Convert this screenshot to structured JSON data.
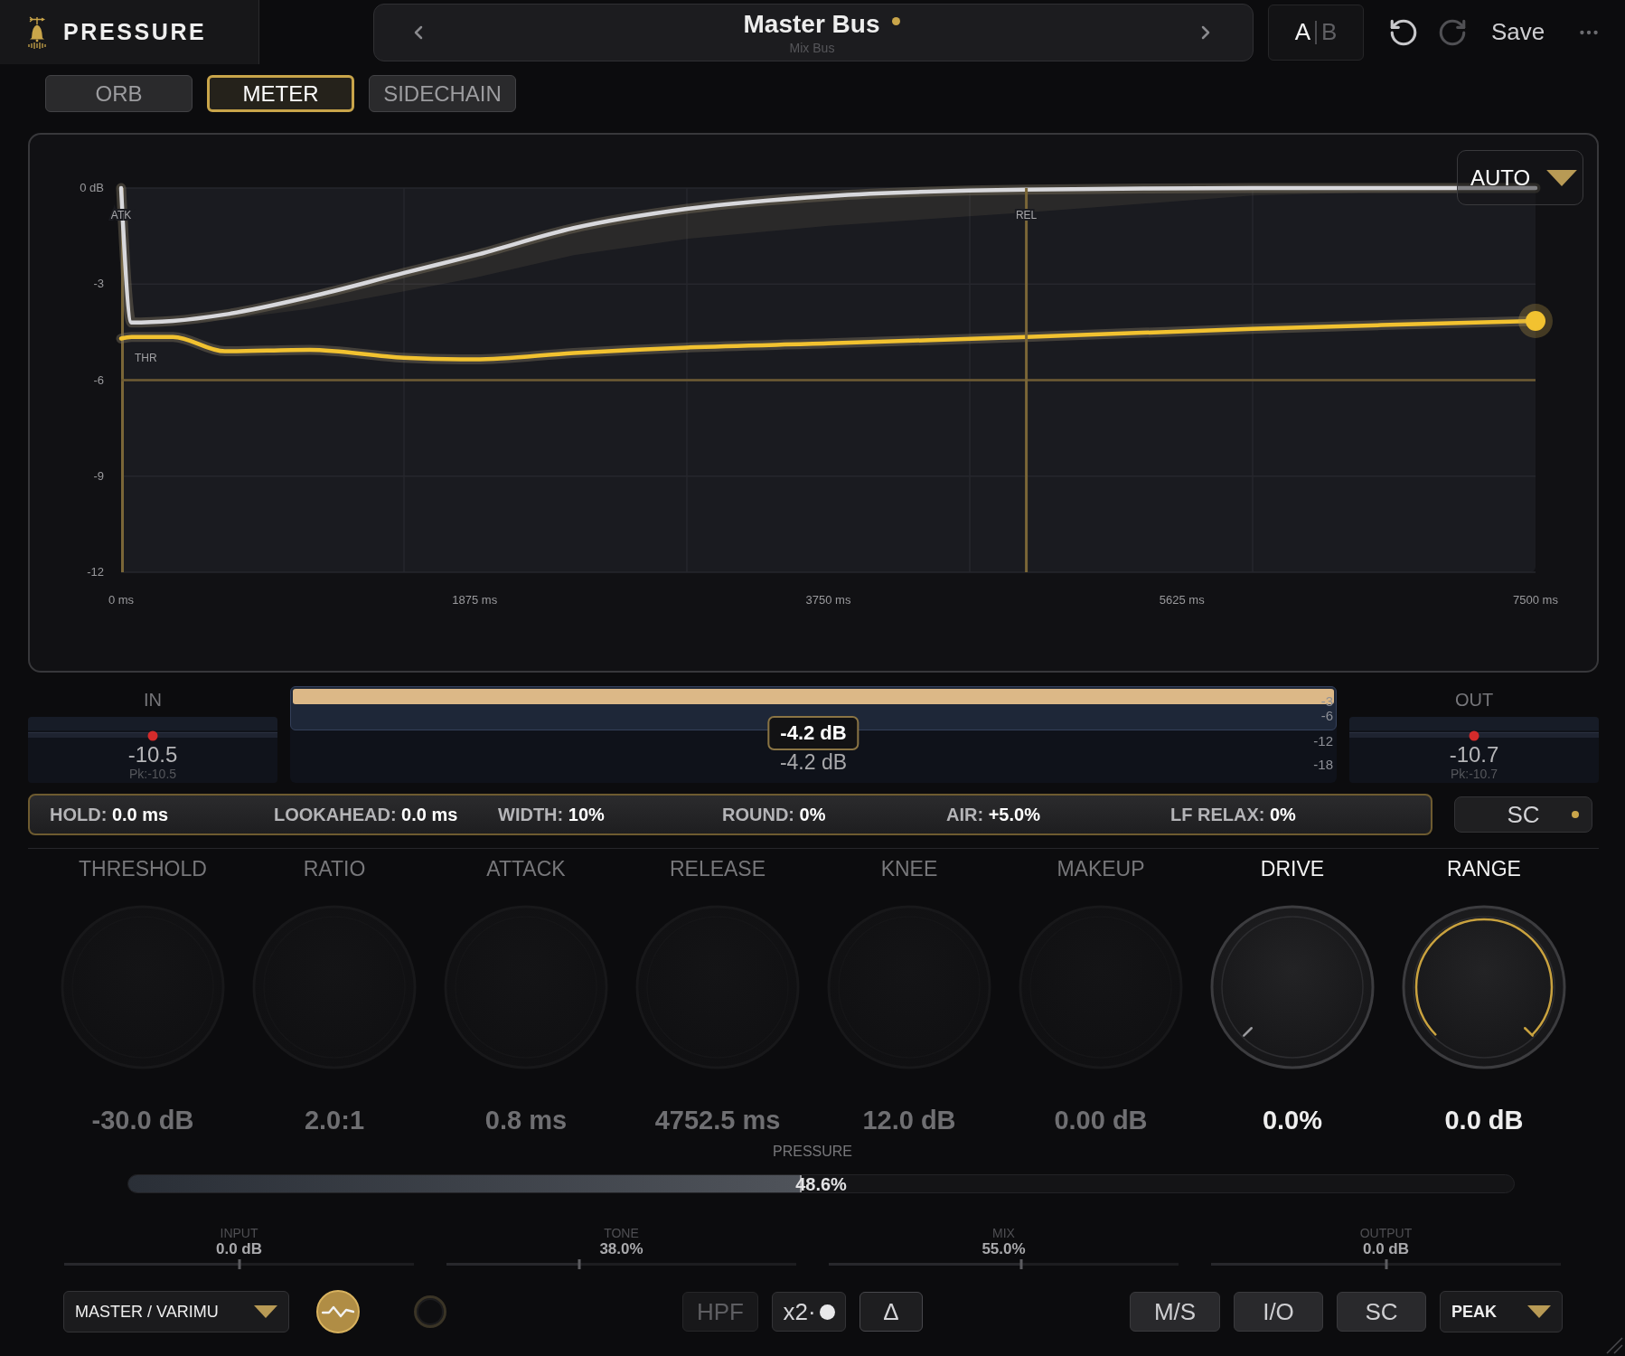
{
  "app": {
    "name": "PRESSURE"
  },
  "preset": {
    "title": "Master Bus",
    "subtitle": "Mix Bus",
    "modified": true
  },
  "ab": [
    {
      "label": "A",
      "selected": true
    },
    {
      "label": "B",
      "selected": false
    }
  ],
  "history": {
    "undo_disabled": false,
    "redo_disabled": true
  },
  "save": "Save",
  "tabs": [
    {
      "label": "ORB",
      "selected": false
    },
    {
      "label": "METER",
      "selected": true
    },
    {
      "label": "SIDECHAIN",
      "selected": false
    }
  ],
  "graph": {
    "mode": "AUTO",
    "chart_data": {
      "type": "line",
      "x": [
        0,
        55,
        275,
        550,
        1000,
        1500,
        1875,
        2400,
        3000,
        3750,
        4800,
        6000,
        7500
      ],
      "series": [
        {
          "color": "#d8d8dc",
          "values": [
            0,
            -4.2,
            -4.15,
            -3.95,
            -3.4,
            -2.65,
            -2.1,
            -1.25,
            -0.65,
            -0.25,
            -0.05,
            0,
            0
          ]
        },
        {
          "color": "#f2c230",
          "values": [
            -4.7,
            -4.65,
            -4.65,
            -5.1,
            -5.05,
            -5.3,
            -5.35,
            -5.15,
            -4.98,
            -4.85,
            -4.65,
            -4.4,
            -4.15
          ]
        }
      ],
      "xlim": [
        0,
        7500
      ],
      "ylim": [
        -12,
        0
      ],
      "xticks": [
        {
          "value": 0,
          "label": "0 ms"
        },
        {
          "value": 1875,
          "label": "1875 ms"
        },
        {
          "value": 3750,
          "label": "3750 ms"
        },
        {
          "value": 5625,
          "label": "5625 ms"
        },
        {
          "value": 7500,
          "label": "7500 ms"
        }
      ],
      "yticks": [
        {
          "value": 0,
          "label": "0 dB"
        },
        {
          "value": -3,
          "label": "-3"
        },
        {
          "value": -6,
          "label": "-6"
        },
        {
          "value": -9,
          "label": "-9"
        },
        {
          "value": -12,
          "label": "-12"
        }
      ],
      "ref_lines": [
        {
          "axis": "x",
          "value": 4800,
          "label": "REL"
        },
        {
          "axis": "y",
          "value": -6,
          "label": "THR"
        }
      ],
      "annotations": [
        {
          "text": "ATK",
          "x": 0,
          "y": -0.85
        }
      ]
    }
  },
  "meters": {
    "in": {
      "label": "IN",
      "level": 0.5,
      "reading": "-10.5",
      "peak": "Pk:-10.5"
    },
    "gain_reduction": {
      "level": 1,
      "scale": [
        "-3",
        "-6",
        "-12",
        "-18"
      ],
      "tooltip": "-4.2 dB",
      "reading": "-4.2 dB"
    },
    "out": {
      "label": "OUT",
      "level": 0.5,
      "reading": "-10.7",
      "peak": "Pk:-10.7"
    }
  },
  "params": [
    {
      "label": "HOLD:",
      "value": "0.0 ms"
    },
    {
      "label": "LOOKAHEAD:",
      "value": "0.0 ms"
    },
    {
      "label": "WIDTH:",
      "value": "10%"
    },
    {
      "label": "ROUND:",
      "value": "0%"
    },
    {
      "label": "AIR:",
      "value": "+5.0%"
    },
    {
      "label": "LF RELAX:",
      "value": "0%"
    }
  ],
  "sidechain_toggle": {
    "label": "SC",
    "on": true
  },
  "knobs": [
    {
      "label": "THRESHOLD",
      "value": "-30.0 dB",
      "disabled": true
    },
    {
      "label": "RATIO",
      "value": "2.0:1",
      "disabled": true
    },
    {
      "label": "ATTACK",
      "value": "0.8 ms",
      "disabled": true
    },
    {
      "label": "RELEASE",
      "value": "4752.5 ms",
      "disabled": true
    },
    {
      "label": "KNEE",
      "value": "12.0 dB",
      "disabled": true
    },
    {
      "label": "MAKEUP",
      "value": "0.00 dB",
      "disabled": true
    },
    {
      "label": "DRIVE",
      "value": "0.0%",
      "disabled": false
    },
    {
      "label": "RANGE",
      "value": "0.0 dB",
      "disabled": false,
      "level": 1
    }
  ],
  "pressure": {
    "label": "PRESSURE",
    "level": 0.486,
    "value": "48.6%"
  },
  "sliders": [
    {
      "label": "INPUT",
      "value": "0.0 dB",
      "level": 0.5
    },
    {
      "label": "TONE",
      "value": "38.0%",
      "level": 0.38
    },
    {
      "label": "MIX",
      "value": "55.0%",
      "level": 0.55
    },
    {
      "label": "OUTPUT",
      "value": "0.0 dB",
      "level": 0.5
    }
  ],
  "footer": {
    "mode": "MASTER / VARIMU",
    "wave_on": true,
    "toggles": [
      {
        "label": "HPF",
        "disabled": true,
        "kind": "plain"
      },
      {
        "label": "x2·",
        "disabled": false,
        "kind": "dot"
      },
      {
        "label": "Δ",
        "disabled": false,
        "kind": "outlined"
      }
    ],
    "routing": [
      "M/S",
      "I/O",
      "SC"
    ],
    "detector": "PEAK"
  }
}
